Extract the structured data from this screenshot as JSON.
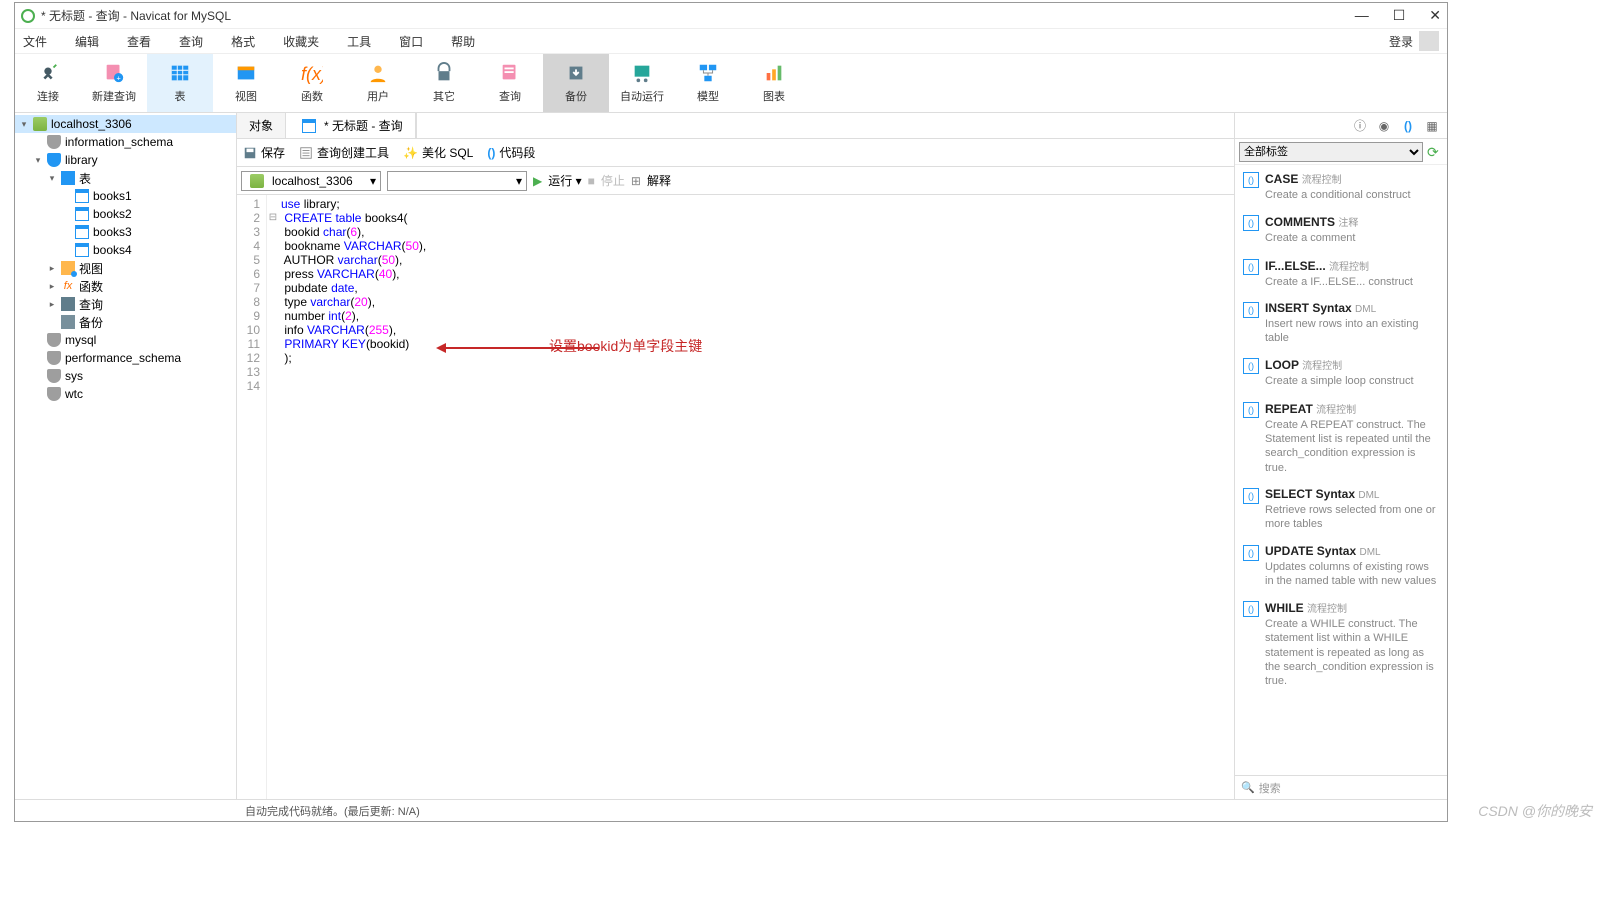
{
  "title": "* 无标题 - 查询 - Navicat for MySQL",
  "menu": [
    "文件",
    "编辑",
    "查看",
    "查询",
    "格式",
    "收藏夹",
    "工具",
    "窗口",
    "帮助"
  ],
  "login": "登录",
  "toolbar": [
    {
      "label": "连接",
      "key": "connect"
    },
    {
      "label": "新建查询",
      "key": "new-query"
    },
    {
      "label": "表",
      "key": "table",
      "active": true
    },
    {
      "label": "视图",
      "key": "view"
    },
    {
      "label": "函数",
      "key": "function"
    },
    {
      "label": "用户",
      "key": "user"
    },
    {
      "label": "其它",
      "key": "other"
    },
    {
      "label": "查询",
      "key": "query"
    },
    {
      "label": "备份",
      "key": "backup",
      "sel": true
    },
    {
      "label": "自动运行",
      "key": "autorun"
    },
    {
      "label": "模型",
      "key": "model"
    },
    {
      "label": "图表",
      "key": "chart"
    }
  ],
  "tree": {
    "conn": "localhost_3306",
    "dbs_closed": [
      "information_schema"
    ],
    "db_open": "library",
    "tables_label": "表",
    "tables": [
      "books1",
      "books2",
      "books3",
      "books4"
    ],
    "view": "视图",
    "fx": "函数",
    "query": "查询",
    "backup": "备份",
    "other_dbs": [
      "mysql",
      "performance_schema",
      "sys",
      "wtc"
    ]
  },
  "tabs": {
    "objects": "对象",
    "query": "* 无标题 - 查询"
  },
  "sub": {
    "save": "保存",
    "builder": "查询创建工具",
    "beautify": "美化 SQL",
    "snippet": "代码段"
  },
  "conn_sel": "localhost_3306",
  "run": {
    "run": "运行",
    "stop": "停止",
    "explain": "解释"
  },
  "code_lines": [
    [
      {
        "t": "use ",
        "c": "kw"
      },
      {
        "t": "library;",
        "c": "id"
      }
    ],
    [
      {
        "t": "CREATE table ",
        "c": "kw"
      },
      {
        "t": "books4(",
        "c": "id"
      }
    ],
    [
      {
        "t": "bookid ",
        "c": "id"
      },
      {
        "t": "char",
        "c": "kw"
      },
      {
        "t": "(",
        "c": "id"
      },
      {
        "t": "6",
        "c": "num"
      },
      {
        "t": "),",
        "c": "id"
      }
    ],
    [
      {
        "t": "bookname ",
        "c": "id"
      },
      {
        "t": "VARCHAR",
        "c": "kw"
      },
      {
        "t": "(",
        "c": "id"
      },
      {
        "t": "50",
        "c": "num"
      },
      {
        "t": "),",
        "c": "id"
      }
    ],
    [
      {
        "t": "AUTHOR ",
        "c": "id"
      },
      {
        "t": "varchar",
        "c": "kw"
      },
      {
        "t": "(",
        "c": "id"
      },
      {
        "t": "50",
        "c": "num"
      },
      {
        "t": "),",
        "c": "id"
      }
    ],
    [
      {
        "t": "press ",
        "c": "id"
      },
      {
        "t": "VARCHAR",
        "c": "kw"
      },
      {
        "t": "(",
        "c": "id"
      },
      {
        "t": "40",
        "c": "num"
      },
      {
        "t": "),",
        "c": "id"
      }
    ],
    [
      {
        "t": "pubdate ",
        "c": "id"
      },
      {
        "t": "date",
        "c": "kw"
      },
      {
        "t": ",",
        "c": "id"
      }
    ],
    [
      {
        "t": "type ",
        "c": "id"
      },
      {
        "t": "varchar",
        "c": "kw"
      },
      {
        "t": "(",
        "c": "id"
      },
      {
        "t": "20",
        "c": "num"
      },
      {
        "t": "),",
        "c": "id"
      }
    ],
    [
      {
        "t": "number ",
        "c": "id"
      },
      {
        "t": "int",
        "c": "kw"
      },
      {
        "t": "(",
        "c": "id"
      },
      {
        "t": "2",
        "c": "num"
      },
      {
        "t": "),",
        "c": "id"
      }
    ],
    [
      {
        "t": "info ",
        "c": "id"
      },
      {
        "t": "VARCHAR",
        "c": "kw"
      },
      {
        "t": "(",
        "c": "id"
      },
      {
        "t": "255",
        "c": "num"
      },
      {
        "t": "),",
        "c": "id"
      }
    ],
    [
      {
        "t": "PRIMARY KEY",
        "c": "kw"
      },
      {
        "t": "(bookid)",
        "c": "id"
      }
    ],
    [
      {
        "t": ");",
        "c": "id"
      }
    ]
  ],
  "annotation": "设置bookid为单字段主键",
  "right": {
    "filter": "全部标签",
    "snippets": [
      {
        "title": "CASE",
        "tag": "流程控制",
        "desc": "Create a conditional construct"
      },
      {
        "title": "COMMENTS",
        "tag": "注释",
        "desc": "Create a comment"
      },
      {
        "title": "IF...ELSE...",
        "tag": "流程控制",
        "desc": "Create a IF...ELSE... construct"
      },
      {
        "title": "INSERT Syntax",
        "tag": "DML",
        "desc": "Insert new rows into an existing table"
      },
      {
        "title": "LOOP",
        "tag": "流程控制",
        "desc": "Create a simple loop construct"
      },
      {
        "title": "REPEAT",
        "tag": "流程控制",
        "desc": "Create A REPEAT construct. The Statement list is repeated until the search_condition expression is true."
      },
      {
        "title": "SELECT Syntax",
        "tag": "DML",
        "desc": "Retrieve rows selected from one or more tables"
      },
      {
        "title": "UPDATE Syntax",
        "tag": "DML",
        "desc": "Updates columns of existing rows in the named table with new values"
      },
      {
        "title": "WHILE",
        "tag": "流程控制",
        "desc": "Create a WHILE construct. The statement list within a WHILE statement is repeated as long as the search_condition expression is true."
      }
    ],
    "search": "搜索"
  },
  "status": "自动完成代码就绪。(最后更新: N/A)",
  "watermark": "CSDN @你的晚安"
}
